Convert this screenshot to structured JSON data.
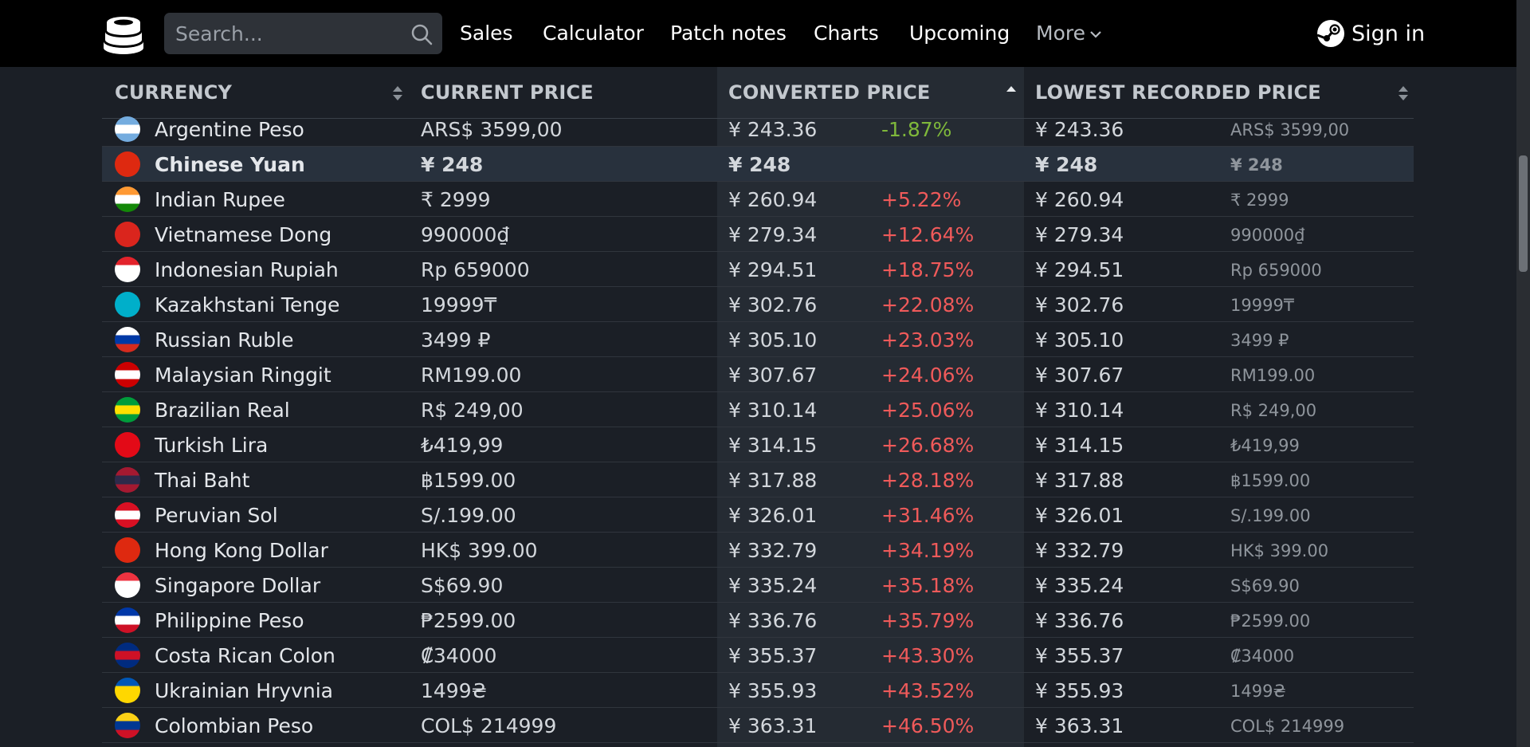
{
  "nav": {
    "search_placeholder": "Search...",
    "links": [
      "Sales",
      "Calculator",
      "Patch notes",
      "Charts",
      "Upcoming"
    ],
    "more_label": "More",
    "signin_label": "Sign in"
  },
  "table": {
    "headers": {
      "currency": "CURRENCY",
      "current_price": "CURRENT PRICE",
      "converted_price": "CONVERTED PRICE",
      "lowest_price": "LOWEST RECORDED PRICE"
    },
    "rows": [
      {
        "name": "Argentine Peso",
        "current": "ARS$ 3599,00",
        "converted": "¥ 243.36",
        "pct": "-1.87%",
        "lowest": "¥ 243.36",
        "lowest_orig": "ARS$ 3599,00",
        "flag": [
          "#74acdf",
          "#ffffff",
          "#74acdf"
        ],
        "dir": "down"
      },
      {
        "name": "Chinese Yuan",
        "current": "¥ 248",
        "converted": "¥ 248",
        "pct": "",
        "lowest": "¥ 248",
        "lowest_orig": "¥ 248",
        "flag": [
          "#de2910",
          "#de2910",
          "#de2910"
        ],
        "dir": "none",
        "highlight": true
      },
      {
        "name": "Indian Rupee",
        "current": "₹ 2999",
        "converted": "¥ 260.94",
        "pct": "+5.22%",
        "lowest": "¥ 260.94",
        "lowest_orig": "₹ 2999",
        "flag": [
          "#ff9933",
          "#ffffff",
          "#138808"
        ],
        "dir": "up"
      },
      {
        "name": "Vietnamese Dong",
        "current": "990000₫",
        "converted": "¥ 279.34",
        "pct": "+12.64%",
        "lowest": "¥ 279.34",
        "lowest_orig": "990000₫",
        "flag": [
          "#da251d",
          "#da251d",
          "#da251d"
        ],
        "dir": "up"
      },
      {
        "name": "Indonesian Rupiah",
        "current": "Rp 659000",
        "converted": "¥ 294.51",
        "pct": "+18.75%",
        "lowest": "¥ 294.51",
        "lowest_orig": "Rp 659000",
        "flag": [
          "#e3232b",
          "#ffffff",
          "#ffffff"
        ],
        "dir": "up"
      },
      {
        "name": "Kazakhstani Tenge",
        "current": "19999₸",
        "converted": "¥ 302.76",
        "pct": "+22.08%",
        "lowest": "¥ 302.76",
        "lowest_orig": "19999₸",
        "flag": [
          "#00afca",
          "#00afca",
          "#00afca"
        ],
        "dir": "up"
      },
      {
        "name": "Russian Ruble",
        "current": "3499 ₽",
        "converted": "¥ 305.10",
        "pct": "+23.03%",
        "lowest": "¥ 305.10",
        "lowest_orig": "3499 ₽",
        "flag": [
          "#ffffff",
          "#0039a6",
          "#d52b1e"
        ],
        "dir": "up"
      },
      {
        "name": "Malaysian Ringgit",
        "current": "RM199.00",
        "converted": "¥ 307.67",
        "pct": "+24.06%",
        "lowest": "¥ 307.67",
        "lowest_orig": "RM199.00",
        "flag": [
          "#cc0001",
          "#ffffff",
          "#cc0001"
        ],
        "dir": "up"
      },
      {
        "name": "Brazilian Real",
        "current": "R$ 249,00",
        "converted": "¥ 310.14",
        "pct": "+25.06%",
        "lowest": "¥ 310.14",
        "lowest_orig": "R$ 249,00",
        "flag": [
          "#009c3b",
          "#ffdf00",
          "#009c3b"
        ],
        "dir": "up"
      },
      {
        "name": "Turkish Lira",
        "current": "₺419,99",
        "converted": "¥ 314.15",
        "pct": "+26.68%",
        "lowest": "¥ 314.15",
        "lowest_orig": "₺419,99",
        "flag": [
          "#e30a17",
          "#e30a17",
          "#e30a17"
        ],
        "dir": "up"
      },
      {
        "name": "Thai Baht",
        "current": "฿1599.00",
        "converted": "¥ 317.88",
        "pct": "+28.18%",
        "lowest": "¥ 317.88",
        "lowest_orig": "฿1599.00",
        "flag": [
          "#a51931",
          "#2d2a4a",
          "#a51931"
        ],
        "dir": "up"
      },
      {
        "name": "Peruvian Sol",
        "current": "S/.199.00",
        "converted": "¥ 326.01",
        "pct": "+31.46%",
        "lowest": "¥ 326.01",
        "lowest_orig": "S/.199.00",
        "flag": [
          "#d91023",
          "#ffffff",
          "#d91023"
        ],
        "dir": "up"
      },
      {
        "name": "Hong Kong Dollar",
        "current": "HK$ 399.00",
        "converted": "¥ 332.79",
        "pct": "+34.19%",
        "lowest": "¥ 332.79",
        "lowest_orig": "HK$ 399.00",
        "flag": [
          "#de2910",
          "#de2910",
          "#de2910"
        ],
        "dir": "up"
      },
      {
        "name": "Singapore Dollar",
        "current": "S$69.90",
        "converted": "¥ 335.24",
        "pct": "+35.18%",
        "lowest": "¥ 335.24",
        "lowest_orig": "S$69.90",
        "flag": [
          "#ef3340",
          "#ffffff",
          "#ffffff"
        ],
        "dir": "up"
      },
      {
        "name": "Philippine Peso",
        "current": "₱2599.00",
        "converted": "¥ 336.76",
        "pct": "+35.79%",
        "lowest": "¥ 336.76",
        "lowest_orig": "₱2599.00",
        "flag": [
          "#0038a8",
          "#ffffff",
          "#ce1126"
        ],
        "dir": "up"
      },
      {
        "name": "Costa Rican Colon",
        "current": "₡34000",
        "converted": "¥ 355.37",
        "pct": "+43.30%",
        "lowest": "¥ 355.37",
        "lowest_orig": "₡34000",
        "flag": [
          "#002b7f",
          "#ce1126",
          "#002b7f"
        ],
        "dir": "up"
      },
      {
        "name": "Ukrainian Hryvnia",
        "current": "1499₴",
        "converted": "¥ 355.93",
        "pct": "+43.52%",
        "lowest": "¥ 355.93",
        "lowest_orig": "1499₴",
        "flag": [
          "#0057b7",
          "#ffd700",
          "#ffd700"
        ],
        "dir": "up"
      },
      {
        "name": "Colombian Peso",
        "current": "COL$ 214999",
        "converted": "¥ 363.31",
        "pct": "+46.50%",
        "lowest": "¥ 363.31",
        "lowest_orig": "COL$ 214999",
        "flag": [
          "#fcd116",
          "#003893",
          "#ce1126"
        ],
        "dir": "up"
      }
    ]
  }
}
